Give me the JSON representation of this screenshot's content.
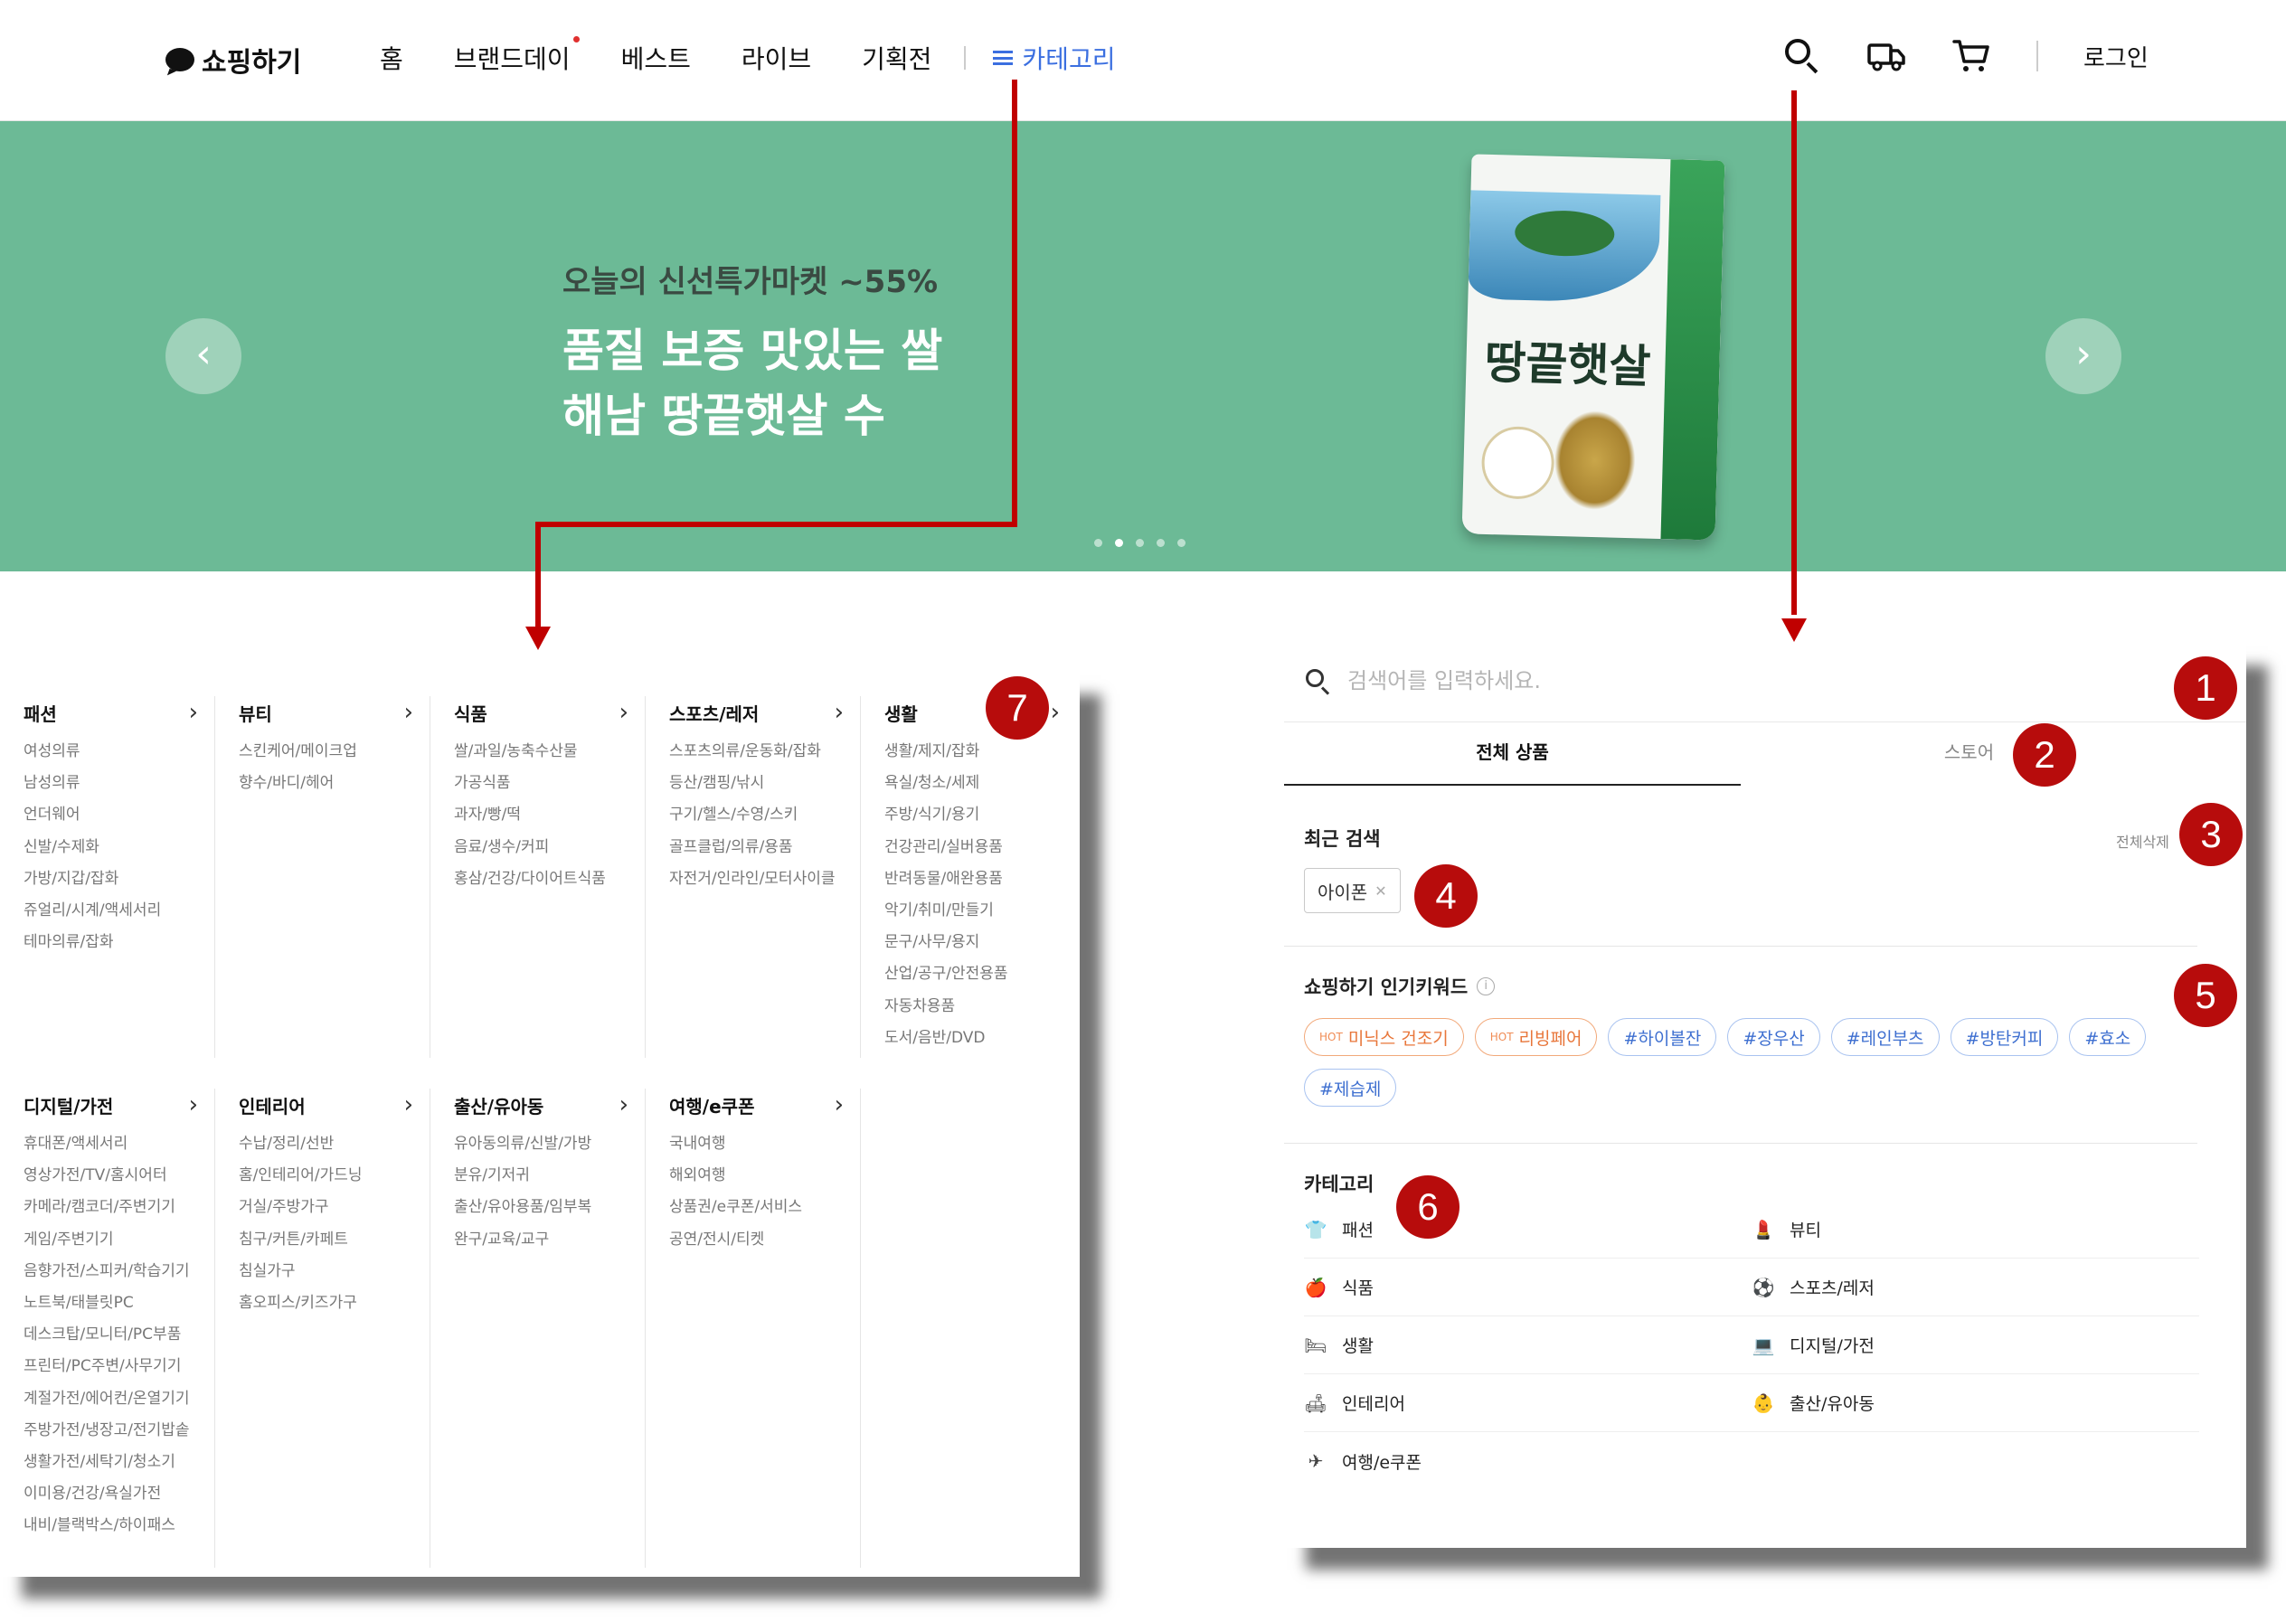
{
  "header": {
    "logo": "쇼핑하기",
    "nav": [
      "홈",
      "브랜드데이",
      "베스트",
      "라이브",
      "기획전"
    ],
    "category_label": "카테고리",
    "login": "로그인"
  },
  "banner": {
    "subtitle": "오늘의 신선특가마켓 ~55%",
    "title": "품질 보증 맛있는 쌀\n해남 땅끝햇살 수",
    "prev": "‹",
    "next": "›",
    "product_name": "땅끝햇살"
  },
  "category_menu": {
    "columns_row1": [
      {
        "title": "패션",
        "items": [
          "여성의류",
          "남성의류",
          "언더웨어",
          "신발/수제화",
          "가방/지갑/잡화",
          "쥬얼리/시계/액세서리",
          "테마의류/잡화"
        ]
      },
      {
        "title": "뷰티",
        "items": [
          "스킨케어/메이크업",
          "향수/바디/헤어"
        ]
      },
      {
        "title": "식품",
        "items": [
          "쌀/과일/농축수산물",
          "가공식품",
          "과자/빵/떡",
          "음료/생수/커피",
          "홍삼/건강/다이어트식품"
        ]
      },
      {
        "title": "스포츠/레저",
        "items": [
          "스포츠의류/운동화/잡화",
          "등산/캠핑/낚시",
          "구기/헬스/수영/스키",
          "골프클럽/의류/용품",
          "자전거/인라인/모터사이클"
        ]
      },
      {
        "title": "생활",
        "items": [
          "생활/제지/잡화",
          "욕실/청소/세제",
          "주방/식기/용기",
          "건강관리/실버용품",
          "반려동물/애완용품",
          "악기/취미/만들기",
          "문구/사무/용지",
          "산업/공구/안전용품",
          "자동차용품",
          "도서/음반/DVD"
        ]
      }
    ],
    "columns_row2": [
      {
        "title": "디지털/가전",
        "items": [
          "휴대폰/액세서리",
          "영상가전/TV/홈시어터",
          "카메라/캠코더/주변기기",
          "게임/주변기기",
          "음향가전/스피커/학습기기",
          "노트북/태블릿PC",
          "데스크탑/모니터/PC부품",
          "프린터/PC주변/사무기기",
          "계절가전/에어컨/온열기기",
          "주방가전/냉장고/전기밥솥",
          "생활가전/세탁기/청소기",
          "이미용/건강/욕실가전",
          "내비/블랙박스/하이패스"
        ]
      },
      {
        "title": "인테리어",
        "items": [
          "수납/정리/선반",
          "홈/인테리어/가드닝",
          "거실/주방가구",
          "침구/커튼/카페트",
          "침실가구",
          "홈오피스/키즈가구"
        ]
      },
      {
        "title": "출산/유아동",
        "items": [
          "유아동의류/신발/가방",
          "분유/기저귀",
          "출산/유아용품/임부복",
          "완구/교육/교구"
        ]
      },
      {
        "title": "여행/e쿠폰",
        "items": [
          "국내여행",
          "해외여행",
          "상품권/e쿠폰/서비스",
          "공연/전시/티켓"
        ]
      }
    ]
  },
  "search_panel": {
    "placeholder": "검색어를 입력하세요.",
    "tabs": [
      "전체 상품",
      "스토어"
    ],
    "recent_title": "최근 검색",
    "clear_all": "전체삭제",
    "recent_items": [
      "아이폰"
    ],
    "popular_title": "쇼핑하기 인기키워드",
    "hot_label": "HOT",
    "keywords": [
      {
        "text": "미닉스 건조기",
        "hot": true
      },
      {
        "text": "리빙페어",
        "hot": true
      },
      {
        "text": "#하이볼잔",
        "hot": false
      },
      {
        "text": "#장우산",
        "hot": false
      },
      {
        "text": "#레인부츠",
        "hot": false
      },
      {
        "text": "#방탄커피",
        "hot": false
      },
      {
        "text": "#효소",
        "hot": false
      },
      {
        "text": "#제습제",
        "hot": false
      }
    ],
    "category_title": "카테고리",
    "categories": [
      {
        "label": "패션",
        "icon": "shirt-icon",
        "glyph": "👕"
      },
      {
        "label": "뷰티",
        "icon": "lipstick-icon",
        "glyph": "💄"
      },
      {
        "label": "식품",
        "icon": "apple-icon",
        "glyph": "🍎"
      },
      {
        "label": "스포츠/레저",
        "icon": "ball-icon",
        "glyph": "⚽"
      },
      {
        "label": "생활",
        "icon": "bed-icon",
        "glyph": "🛏"
      },
      {
        "label": "디지털/가전",
        "icon": "laptop-icon",
        "glyph": "💻"
      },
      {
        "label": "인테리어",
        "icon": "sofa-icon",
        "glyph": "🛋"
      },
      {
        "label": "출산/유아동",
        "icon": "stroller-icon",
        "glyph": "👶"
      },
      {
        "label": "여행/e쿠폰",
        "icon": "plane-icon",
        "glyph": "✈"
      }
    ]
  },
  "markers": [
    "1",
    "2",
    "3",
    "4",
    "5",
    "6",
    "7"
  ],
  "colors": {
    "banner_bg": "#6cba96",
    "accent_blue": "#3b6fe0",
    "annotation_red": "#c00000",
    "marker_red": "#b70c0c",
    "hot_orange": "#e8763a"
  }
}
